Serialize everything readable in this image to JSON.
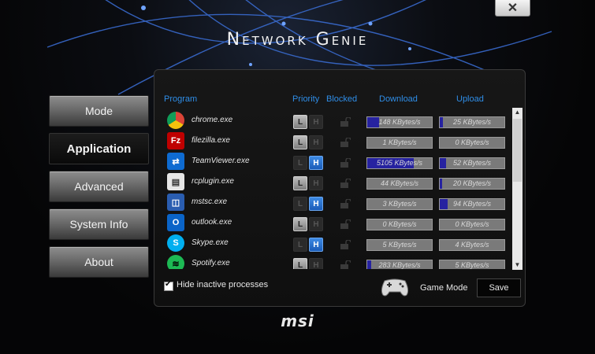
{
  "window": {
    "title": "Network Genie",
    "close_glyph": "✕"
  },
  "logo": "msi",
  "colors": {
    "accent": "#2f8ee8",
    "bar_fill": "#2622a0"
  },
  "nav": {
    "items": [
      {
        "label": "Mode",
        "active": false
      },
      {
        "label": "Application",
        "active": true
      },
      {
        "label": "Advanced",
        "active": false
      },
      {
        "label": "System Info",
        "active": false
      },
      {
        "label": "About",
        "active": false
      }
    ]
  },
  "table": {
    "headers": {
      "program": "Program",
      "priority": "Priority",
      "blocked": "Blocked",
      "download": "Download",
      "upload": "Upload"
    },
    "priority_labels": {
      "low": "L",
      "high": "H"
    },
    "rows": [
      {
        "name": "chrome.exe",
        "icon": "chrome-icon",
        "priority": "L",
        "download": "148 KBytes/s",
        "download_level": 0.18,
        "upload": "25 KBytes/s",
        "upload_level": 0.05
      },
      {
        "name": "filezilla.exe",
        "icon": "filezilla-icon",
        "priority": "L",
        "download": "1 KBytes/s",
        "download_level": 0.0,
        "upload": "0 KBytes/s",
        "upload_level": 0.0
      },
      {
        "name": "TeamViewer.exe",
        "icon": "teamviewer-icon",
        "priority": "H",
        "download": "5105 KBytes/s",
        "download_level": 0.72,
        "upload": "52 KBytes/s",
        "upload_level": 0.1
      },
      {
        "name": "rcplugin.exe",
        "icon": "rcplugin-icon",
        "priority": "L",
        "download": "44 KBytes/s",
        "download_level": 0.0,
        "upload": "20 KBytes/s",
        "upload_level": 0.04
      },
      {
        "name": "mstsc.exe",
        "icon": "mstsc-icon",
        "priority": "H",
        "download": "3 KBytes/s",
        "download_level": 0.0,
        "upload": "94 KBytes/s",
        "upload_level": 0.12
      },
      {
        "name": "outlook.exe",
        "icon": "outlook-icon",
        "priority": "L",
        "download": "0 KBytes/s",
        "download_level": 0.0,
        "upload": "0 KBytes/s",
        "upload_level": 0.0
      },
      {
        "name": "Skype.exe",
        "icon": "skype-icon",
        "priority": "H",
        "download": "5 KBytes/s",
        "download_level": 0.0,
        "upload": "4 KBytes/s",
        "upload_level": 0.0
      },
      {
        "name": "Spotify.exe",
        "icon": "spotify-icon",
        "priority": "L",
        "download": "283 KBytes/s",
        "download_level": 0.06,
        "upload": "5 KBytes/s",
        "upload_level": 0.0
      }
    ]
  },
  "footer": {
    "hide_inactive_label": "Hide inactive processes",
    "hide_inactive_checked": true,
    "game_mode_label": "Game Mode",
    "save_label": "Save"
  }
}
